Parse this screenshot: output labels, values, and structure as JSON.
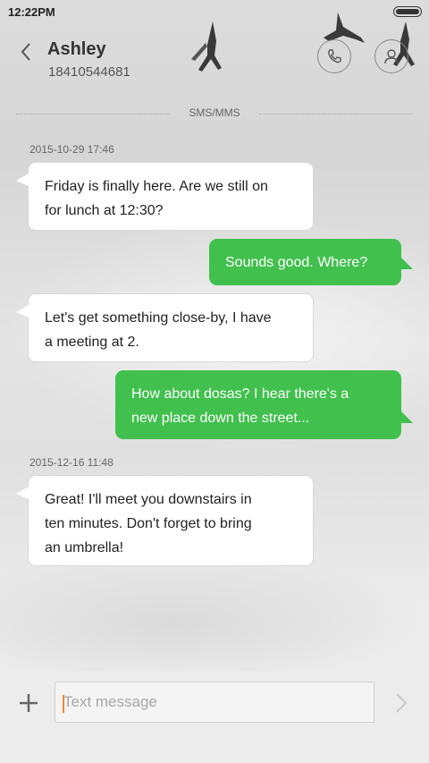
{
  "status_bar": {
    "time": "12:22PM",
    "battery_icon": "battery-full-icon"
  },
  "header": {
    "back_icon": "chevron-left-icon",
    "contact_name": "Ashley",
    "contact_number": "18410544681",
    "call_icon": "phone-icon",
    "contact_icon": "person-icon"
  },
  "conversation": {
    "channel_label": "SMS/MMS",
    "messages": [
      {
        "timestamp": "2015-10-29 17:46",
        "direction": "incoming",
        "lines": [
          "Friday is finally here. Are we still on",
          "for lunch at 12:30?"
        ]
      },
      {
        "direction": "outgoing",
        "lines": [
          "Sounds good. Where?"
        ]
      },
      {
        "direction": "incoming",
        "lines": [
          "Let's get something close-by, I have",
          "a meeting at 2."
        ]
      },
      {
        "direction": "outgoing",
        "lines": [
          "How about dosas? I hear there's a",
          "new place down the street..."
        ]
      },
      {
        "timestamp": "2015-12-16 11:48",
        "direction": "incoming",
        "lines": [
          "Great! I'll meet you downstairs in",
          "ten minutes. Don't forget to bring",
          "an umbrella!"
        ]
      }
    ]
  },
  "compose": {
    "add_icon": "plus-icon",
    "placeholder": "Text message",
    "value": "",
    "send_icon": "chevron-right-icon"
  },
  "colors": {
    "outgoing_bubble": "#41c04e",
    "incoming_bubble": "#ffffff",
    "input_caret": "#f08a2c"
  }
}
